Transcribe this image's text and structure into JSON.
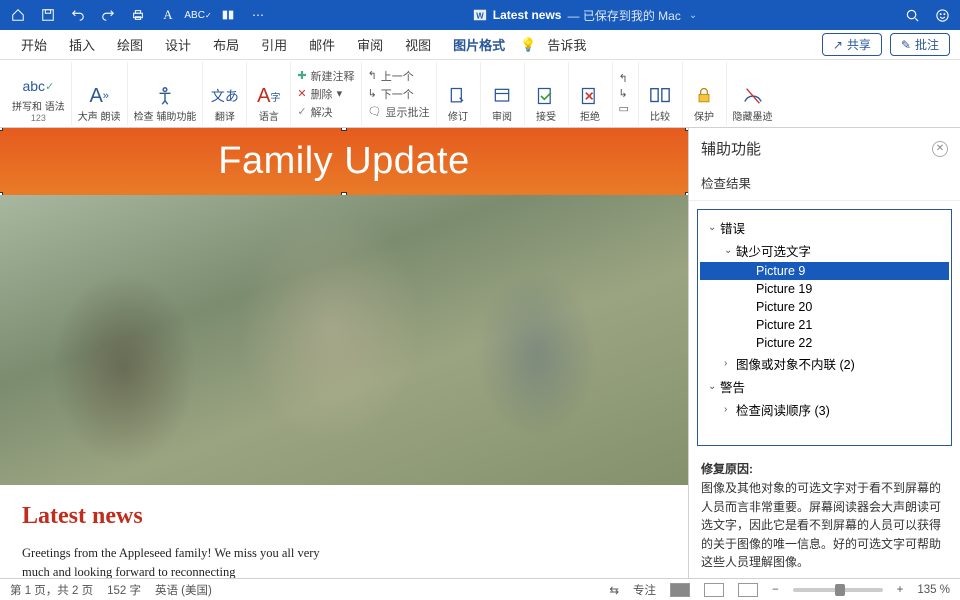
{
  "titlebar": {
    "doc_name": "Latest news",
    "save_status": "— 已保存到我的 Mac"
  },
  "tabs": {
    "items": [
      "开始",
      "插入",
      "绘图",
      "设计",
      "布局",
      "引用",
      "邮件",
      "审阅",
      "视图",
      "图片格式"
    ],
    "active": "图片格式",
    "tellme": "告诉我",
    "share": "共享",
    "pizhu": "批注"
  },
  "ribbon": {
    "spelling": "拼写和\n语法",
    "spelling_sub": "123",
    "readaloud": "大声\n朗读",
    "a11y": "检查\n辅助功能",
    "translate": "翻译",
    "language": "语言",
    "new_comment": "新建注释",
    "delete": "删除",
    "resolve": "解决",
    "prev": "上一个",
    "next": "下一个",
    "show_markup": "显示批注",
    "track": "修订",
    "review": "审阅",
    "accept": "接受",
    "reject": "拒绝",
    "compare": "比较",
    "protect": "保护",
    "ink": "隐藏墨迹"
  },
  "document": {
    "banner": "Family Update",
    "heading": "Latest news",
    "body": "Greetings from the Appleseed family! We miss you all very much and looking forward to reconnecting"
  },
  "sidepane": {
    "title": "辅助功能",
    "subtitle": "检查结果",
    "tree": {
      "errors_label": "错误",
      "missing_alt_label": "缺少可选文字",
      "items": [
        "Picture 9",
        "Picture 19",
        "Picture 20",
        "Picture 21",
        "Picture 22"
      ],
      "inline_label": "图像或对象不内联  (2)",
      "warnings_label": "警告",
      "reading_order_label": "检查阅读顺序  (3)"
    },
    "fix_title": "修复原因:",
    "fix_text": "图像及其他对象的可选文字对于看不到屏幕的人员而言非常重要。屏幕阅读器会大声朗读可选文字，因此它是看不到屏幕的人员可以获得的关于图像的唯一信息。好的可选文字可帮助这些人员理解图像。"
  },
  "status": {
    "pages": "第 1 页，共 2 页",
    "words": "152 字",
    "lang": "英语 (美国)",
    "focus": "专注",
    "zoom": "135 %"
  }
}
